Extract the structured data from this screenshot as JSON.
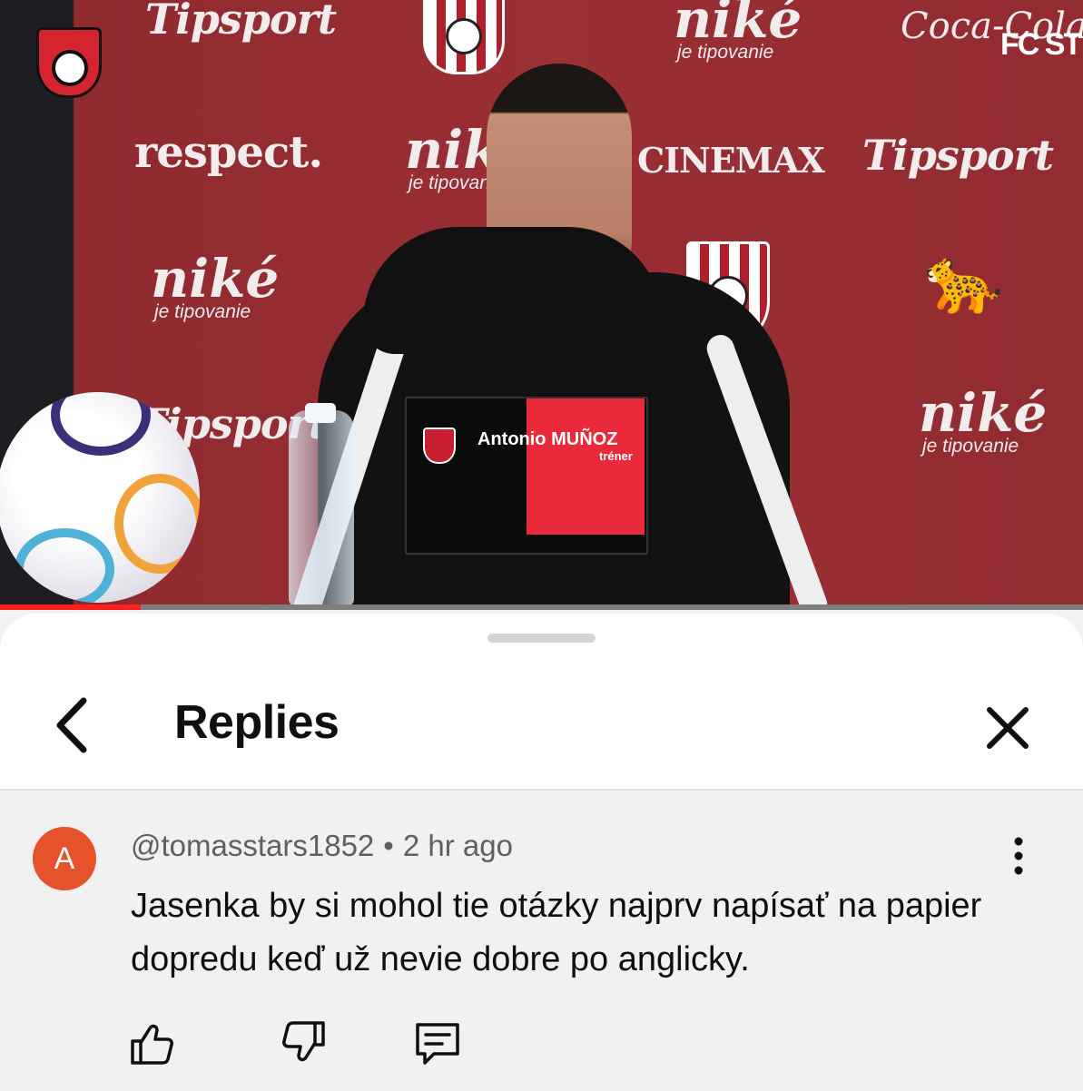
{
  "video": {
    "sponsors": {
      "tipsport": "Tipsport",
      "nike": "niké",
      "nike_tagline": "je tipovanie",
      "respect": "respect.",
      "cinemax": "CINEMAX",
      "cocacola": "Coca-Cola",
      "fcst": "FC ST"
    },
    "nameplate": {
      "name": "Antonio MUÑOZ",
      "role": "tréner"
    },
    "progress": 0.13
  },
  "sheet": {
    "title": "Replies",
    "back_icon": "chevron-left-icon",
    "close_icon": "close-icon"
  },
  "comment": {
    "avatar_letter": "A",
    "avatar_color": "#e6522c",
    "author": "@tomasstars1852",
    "separator": "•",
    "time": "2 hr ago",
    "text": "Jasenka by si mohol tie otázky najprv napísať na papier dopredu keď už nevie dobre po anglicky.",
    "actions": [
      "thumbs-up-icon",
      "thumbs-down-icon",
      "reply-icon"
    ]
  }
}
